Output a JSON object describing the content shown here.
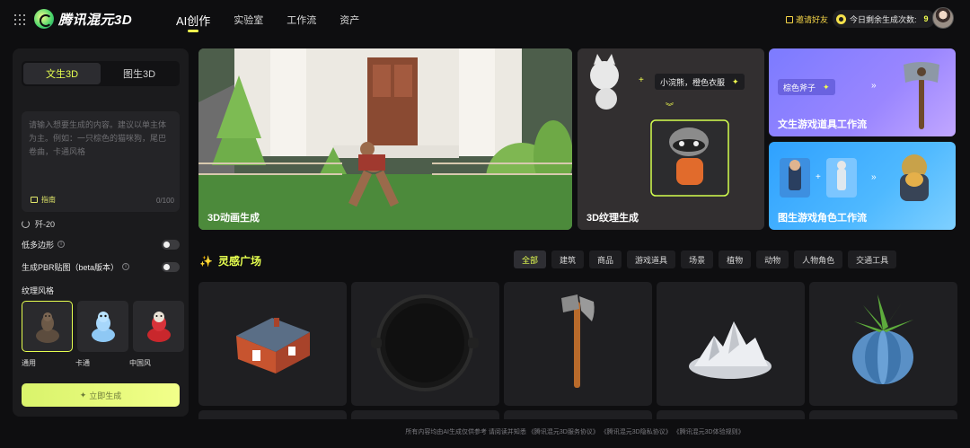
{
  "header": {
    "brand": "腾讯混元3D",
    "nav": [
      "AI创作",
      "实验室",
      "工作流",
      "资产"
    ],
    "invite_label": "邀请好友",
    "quota_label": "今日剩余生成次数:",
    "quota_value": "9"
  },
  "sidebar": {
    "tabs": [
      "文生3D",
      "图生3D"
    ],
    "prompt_placeholder": "请输入想要生成的内容。建议以单主体为主。例如：一只棕色的猫咪狗，尾巴卷曲，卡通风格",
    "guide_label": "指南",
    "counter": "0/100",
    "model": "歼-20",
    "options": [
      {
        "label": "低多边形"
      },
      {
        "label": "生成PBR贴图（beta版本）"
      }
    ],
    "style_title": "纹理风格",
    "styles": [
      "通用",
      "卡通",
      "中国风"
    ],
    "generate_label": "立即生成"
  },
  "banners": {
    "b1_title": "3D动画生成",
    "b2_title": "3D纹理生成",
    "b2_prompt": "小浣熊，橙色衣服",
    "b3_title": "文生游戏道具工作流",
    "b3_prompt": "棕色斧子",
    "b4_title": "图生游戏角色工作流"
  },
  "inspiration": {
    "title": "灵感广场",
    "filters": [
      "全部",
      "建筑",
      "商品",
      "游戏道具",
      "场景",
      "植物",
      "动物",
      "人物角色",
      "交通工具"
    ],
    "cards": [
      "house",
      "pan",
      "axe",
      "mountain",
      "vase-plant"
    ]
  },
  "footer": "所有内容均由AI生成仅供参考 请阅读并知悉 《腾讯混元3D服务协议》 《腾讯混元3D隐私协议》 《腾讯混元3D体验规则》",
  "colors": {
    "accent": "#e6ff4f",
    "bg": "#0e0e10",
    "panel": "#1b1b1d"
  }
}
